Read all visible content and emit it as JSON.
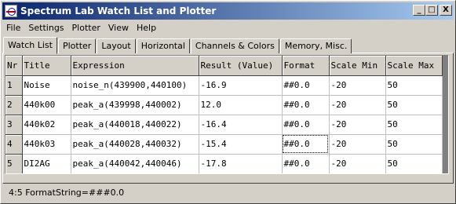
{
  "window": {
    "title": "Spectrum Lab  Watch List and Plotter",
    "buttons": {
      "minimize": "_",
      "maximize": "□",
      "close": "X"
    }
  },
  "menu": [
    "File",
    "Settings",
    "Plotter",
    "View",
    "Help"
  ],
  "tabs": [
    {
      "label": "Watch List",
      "active": true
    },
    {
      "label": "Plotter",
      "active": false
    },
    {
      "label": "Layout",
      "active": false
    },
    {
      "label": "Horizontal",
      "active": false
    },
    {
      "label": "Channels & Colors",
      "active": false
    },
    {
      "label": "Memory, Misc.",
      "active": false
    }
  ],
  "grid": {
    "columns": [
      "Nr",
      "Title",
      "Expression",
      "Result (Value)",
      "Format",
      "Scale Min",
      "Scale Max"
    ],
    "rows": [
      {
        "nr": "1",
        "title": "Noise",
        "expression": "noise_n(439900,440100)",
        "result": "-16.9",
        "format": "##0.0",
        "scale_min": "-20",
        "scale_max": "50"
      },
      {
        "nr": "2",
        "title": "440k00",
        "expression": "peak_a(439998,440002)",
        "result": "12.0",
        "format": "##0.0",
        "scale_min": "-20",
        "scale_max": "50"
      },
      {
        "nr": "3",
        "title": "440k02",
        "expression": "peak_a(440018,440022)",
        "result": "-16.4",
        "format": "##0.0",
        "scale_min": "-20",
        "scale_max": "50"
      },
      {
        "nr": "4",
        "title": "440k03",
        "expression": "peak_a(440028,440032)",
        "result": "-15.4",
        "format": "##0.0",
        "scale_min": "-20",
        "scale_max": "50"
      },
      {
        "nr": "5",
        "title": "DI2AG",
        "expression": "peak_a(440042,440046)",
        "result": "-17.8",
        "format": "##0.0",
        "scale_min": "-20",
        "scale_max": "50"
      }
    ]
  },
  "status": {
    "text": "4:5 FormatString=###0.0"
  },
  "colors": {
    "titlebar_start": "#0a246a",
    "titlebar_end": "#a6caf0",
    "face": "#d4d0c8"
  }
}
